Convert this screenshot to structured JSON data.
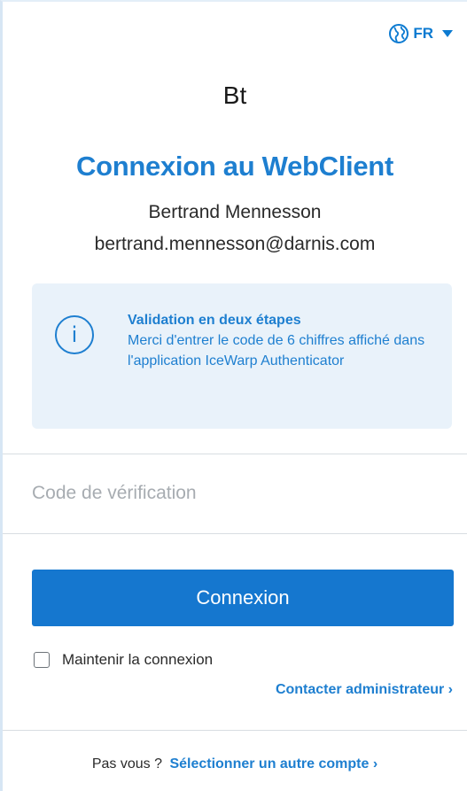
{
  "language": {
    "code": "FR",
    "icon": "globe-icon",
    "dropdown_icon": "caret-down-icon"
  },
  "user": {
    "initials": "Bt",
    "name": "Bertrand Mennesson",
    "email": "bertrand.mennesson@darnis.com"
  },
  "title": "Connexion au WebClient",
  "info": {
    "icon": "info-icon",
    "icon_glyph": "i",
    "title": "Validation en deux étapes",
    "message": "Merci d'entrer le code de 6 chiffres affiché dans l'application IceWarp Authenticator"
  },
  "form": {
    "code_placeholder": "Code de vérification",
    "code_value": "",
    "login_label": "Connexion",
    "remember_label": "Maintenir la connexion",
    "remember_checked": false,
    "admin_link": "Contacter administrateur ›"
  },
  "footer": {
    "prompt": "Pas vous ?",
    "switch_account": "Sélectionner un autre compte ›"
  },
  "colors": {
    "accent": "#1e7fd0",
    "button": "#1577cf",
    "info_bg": "#e9f2fa"
  }
}
